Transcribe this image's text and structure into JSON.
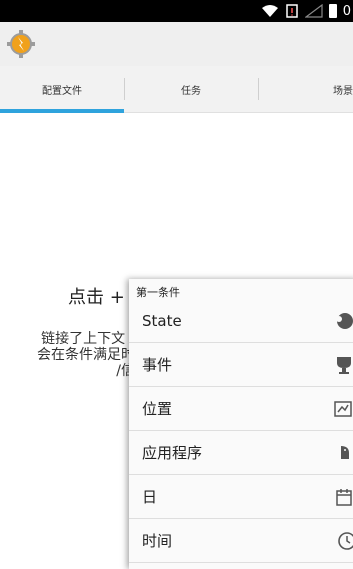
{
  "status_bar": {
    "time": "0"
  },
  "tabs": [
    {
      "label": "配置文件",
      "active": true
    },
    {
      "label": "任务",
      "active": false
    },
    {
      "label": "场景",
      "active": false
    }
  ],
  "empty_state": {
    "prompt": "点击 +",
    "help_lines": [
      "链接了上下文 (",
      "会在条件满足时",
      "/信"
    ]
  },
  "popup": {
    "title": "第一条件",
    "items": [
      {
        "label": "State",
        "icon": "state-icon"
      },
      {
        "label": "事件",
        "icon": "trophy-icon"
      },
      {
        "label": "位置",
        "icon": "map-icon"
      },
      {
        "label": "应用程序",
        "icon": "android-icon"
      },
      {
        "label": "日",
        "icon": "calendar-icon"
      },
      {
        "label": "时间",
        "icon": "clock-icon"
      }
    ]
  },
  "colors": {
    "accent": "#2fa3dd",
    "app_icon": "#f0a11c"
  }
}
